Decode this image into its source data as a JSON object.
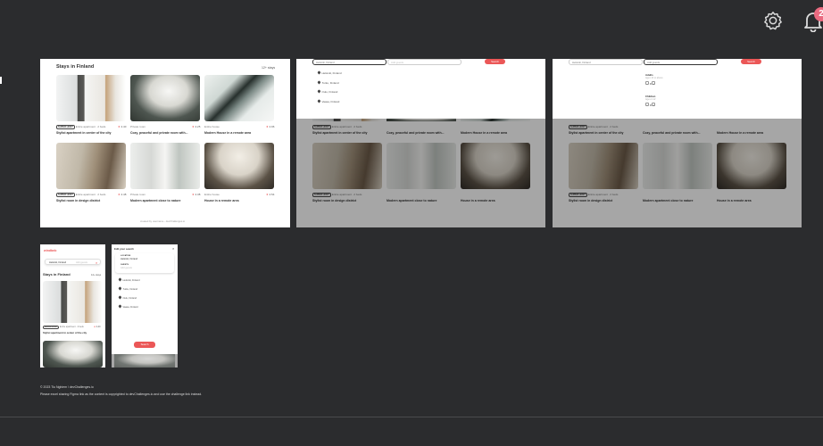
{
  "header": {
    "settings_icon": "gear-icon",
    "notifications_icon": "bell-icon",
    "notification_count": "2"
  },
  "listing": {
    "section_title": "Stays in Finland",
    "stays_count": "12+ stays",
    "super_host": "SUPER HOST",
    "cards": [
      {
        "meta": "Entire apartment . 2 beds",
        "rating": "4.40",
        "title": "Stylist apartment in center of the city",
        "photo": "kitchen"
      },
      {
        "meta": "Private room",
        "rating": "4.25",
        "title": "Cozy, peaceful and private room with...",
        "photo": "window"
      },
      {
        "meta": "Entire house",
        "rating": "4.96",
        "title": "Modern House in a remote area",
        "photo": "stairs"
      },
      {
        "meta": "Entire apartment . 2 beds",
        "rating": "4.48",
        "title": "Stylist room in design district",
        "photo": "room"
      },
      {
        "meta": "Private room",
        "rating": "4.38",
        "title": "Modern apartment close to nature",
        "photo": "bed"
      },
      {
        "meta": "Entire house",
        "rating": "4.54",
        "title": "House in a remote area",
        "photo": "dining"
      }
    ],
    "footer": "created by username - devChallenges.io"
  },
  "search": {
    "location_value": "Helsinki, Finland",
    "guests_placeholder": "Add guests",
    "search_label": "Search",
    "locations": [
      "Helsinki, Finland",
      "Turku, Finland",
      "Oulu, Finland",
      "Vaasa, Finland"
    ],
    "adults_label": "Adults",
    "adults_sub": "Ages 13 or above",
    "children_label": "Children",
    "children_sub": "Ages 2-12",
    "stepper_value": "0"
  },
  "mobile": {
    "logo": "windbnb",
    "location_value": "Helsinki, Finland",
    "guests_placeholder": "Add guests",
    "edit_title": "Edit your search",
    "location_label": "LOCATION",
    "guests_label": "GUESTS"
  },
  "page_footer": {
    "copyright": "© 2023 Tiu Nghiem / devChallenges.io",
    "note": "Please excel sharing Figma link as the content is copyrighted to devChallenges.io and use the challenge link instead."
  },
  "colors": {
    "background": "#2b2c2e",
    "accent": "#eb5757",
    "badge": "#ea6a80"
  }
}
